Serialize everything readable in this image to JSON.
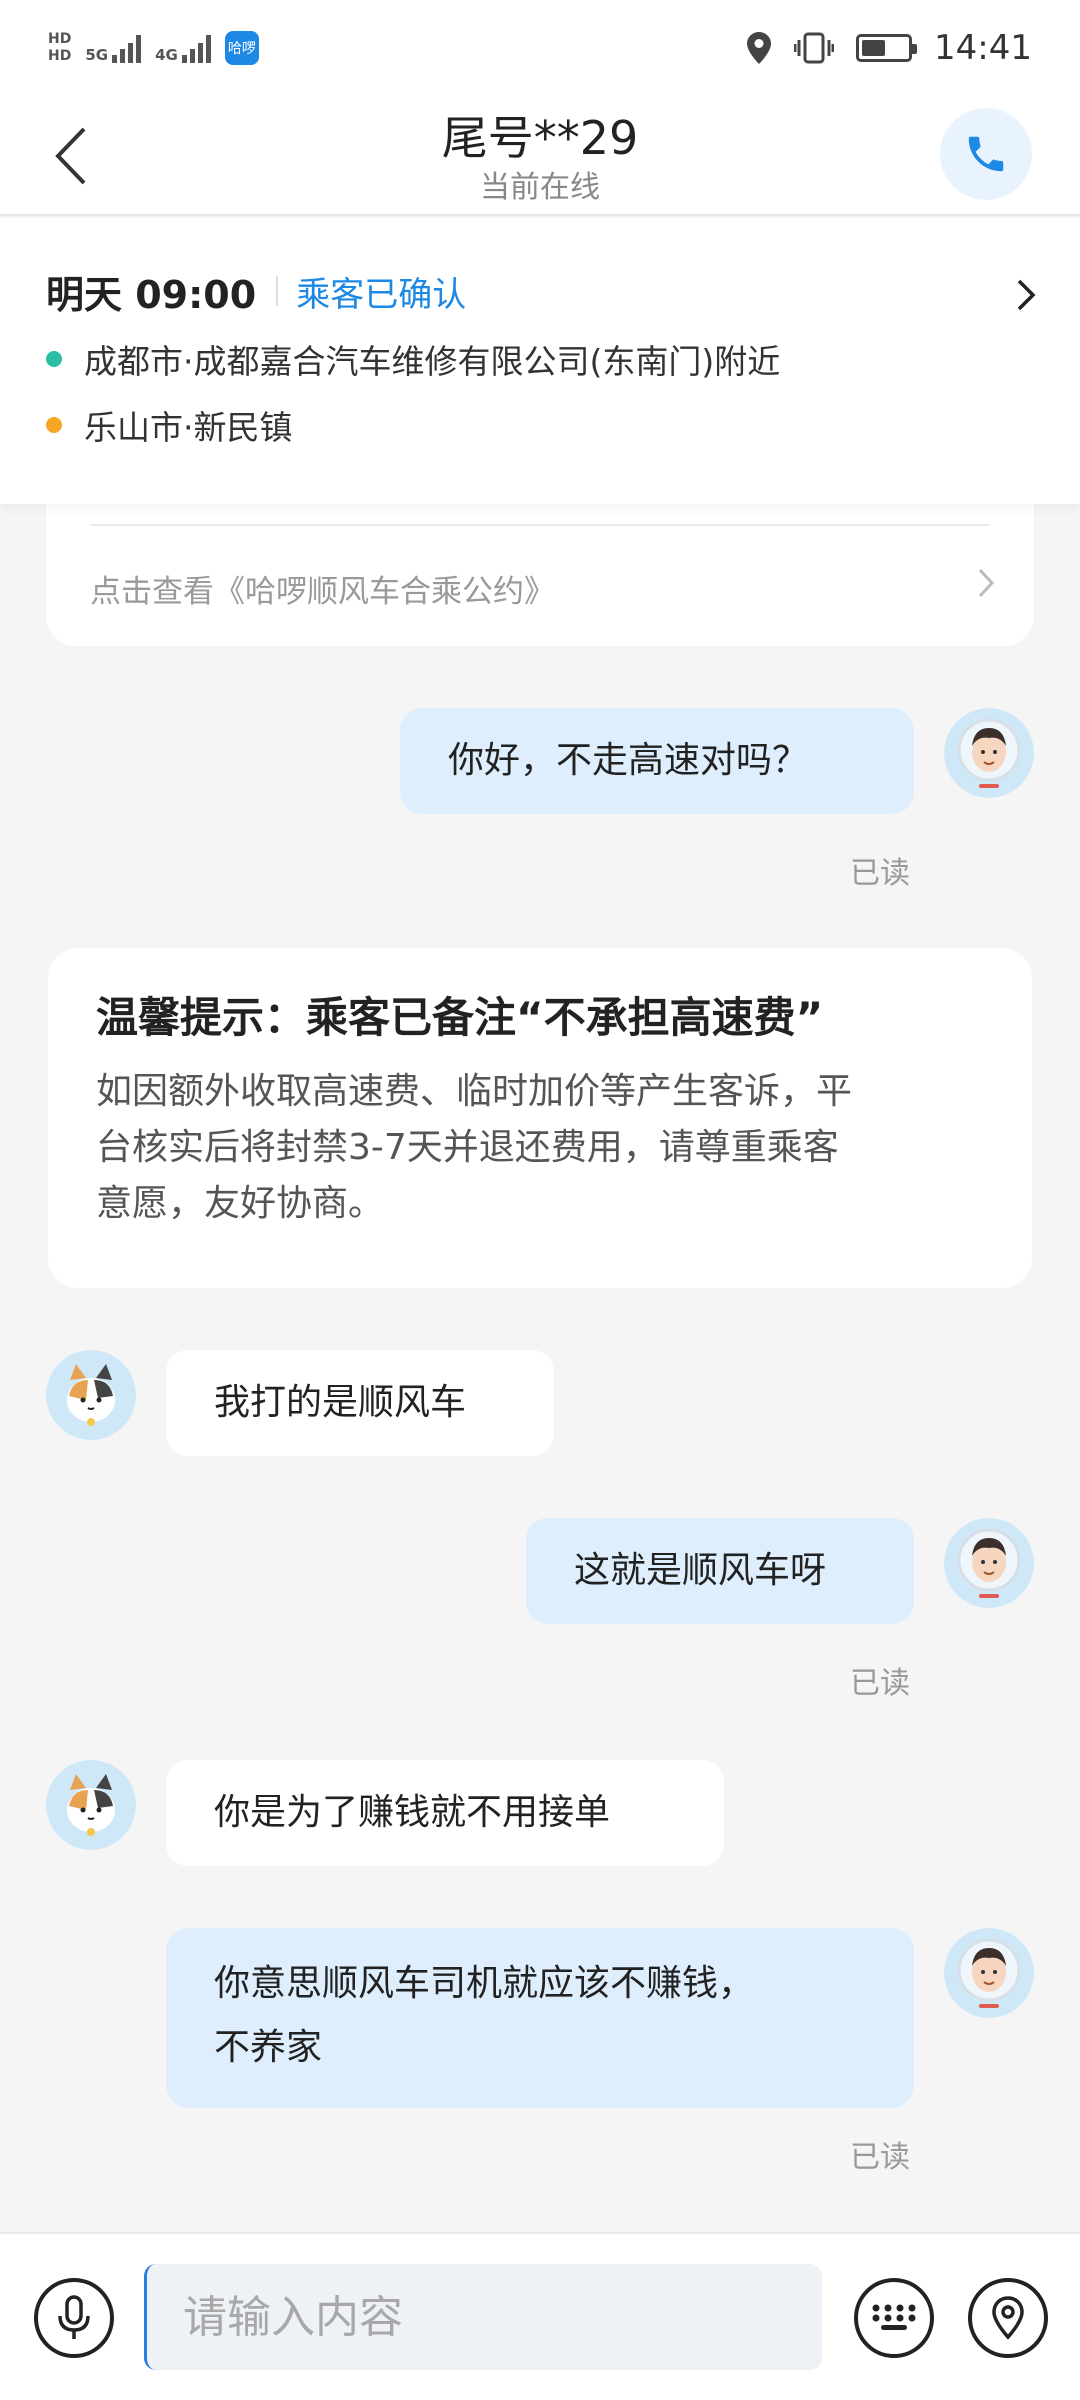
{
  "status_bar": {
    "hd_labels": [
      "HD",
      "HD"
    ],
    "network_1": "5G",
    "network_2": "4G",
    "app_badge": "哈啰",
    "time": "14:41",
    "icons": [
      "location-icon",
      "vibrate-icon",
      "battery-icon"
    ]
  },
  "nav": {
    "title": "尾号**29",
    "subtitle": "当前在线",
    "back_icon": "chevron-left-icon",
    "call_icon": "phone-icon"
  },
  "trip": {
    "time": "明天 09:00",
    "status": "乘客已确认",
    "origin": "成都市·成都嘉合汽车维修有限公司(东南门)附近",
    "destination": "乐山市·新民镇",
    "origin_color": "#2bbfa8",
    "destination_color": "#f5a623"
  },
  "convention": {
    "link_text": "点击查看《哈啰顺风车合乘公约》"
  },
  "messages": [
    {
      "side": "out",
      "text": "你好，不走高速对吗？",
      "read": "已读"
    },
    {
      "side": "in",
      "text": "我打的是顺风车"
    },
    {
      "side": "out",
      "text": "这就是顺风车呀",
      "read": "已读"
    },
    {
      "side": "in",
      "text": "你是为了赚钱就不用接单"
    },
    {
      "side": "out",
      "text_line1": "你意思顺风车司机就应该不赚钱，",
      "text_line2": "不养家",
      "read": "已读"
    }
  ],
  "notice": {
    "title": "温馨提示：乘客已备注“不承担高速费”",
    "line1": "如因额外收取高速费、临时加价等产生客诉，平",
    "line2": "台核实后将封禁3-7天并退还费用，请尊重乘客",
    "line3": "意愿，友好协商。"
  },
  "input_bar": {
    "placeholder": "请输入内容",
    "icons": [
      "microphone-icon",
      "keyboard-icon",
      "location-pin-icon"
    ]
  },
  "colors": {
    "accent": "#1e88e5",
    "bubble_out": "#dfeefc",
    "bubble_in": "#ffffff",
    "background": "#f5f5f5"
  }
}
